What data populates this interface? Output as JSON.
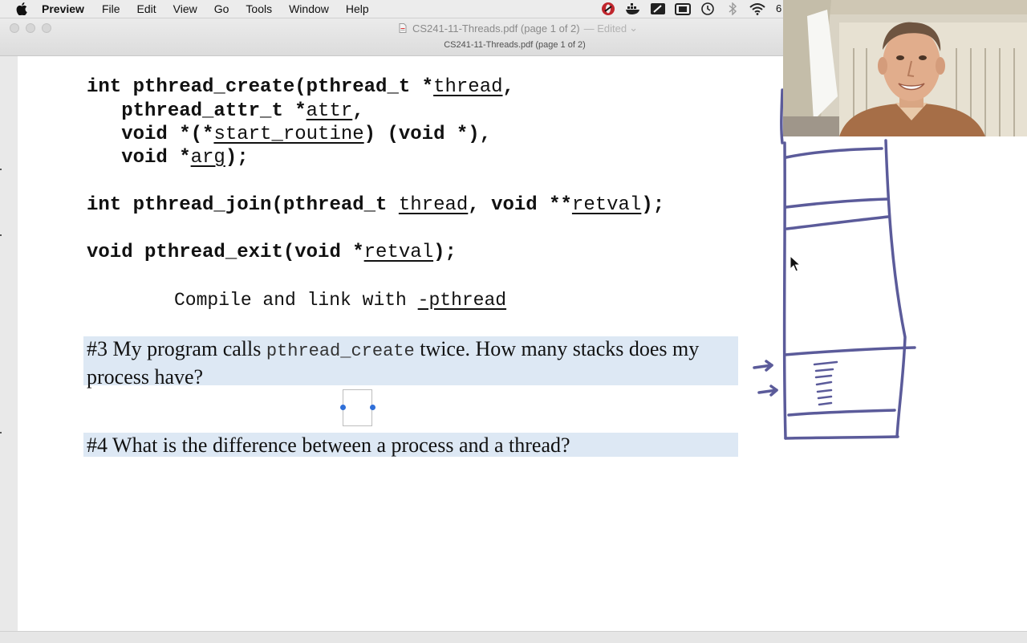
{
  "menubar": {
    "app_name": "Preview",
    "items": [
      "File",
      "Edit",
      "View",
      "Go",
      "Tools",
      "Window",
      "Help"
    ],
    "status_icons": [
      "opera-icon",
      "docker-icon",
      "screen-annotation-icon",
      "screenshot-icon",
      "time-machine-icon",
      "bluetooth-icon",
      "wifi-icon"
    ],
    "battery_text": "6"
  },
  "window": {
    "title": "CS241-11-Threads.pdf (page 1 of 2)",
    "edited_label": "— Edited",
    "chevron": "⌄",
    "subtitle": "CS241-11-Threads.pdf (page 1 of 2)"
  },
  "code": {
    "create_l1": {
      "a": "int pthread_create(pthread_t *",
      "b": "thread",
      "c": ","
    },
    "create_l2": {
      "a": "   pthread_attr_t *",
      "b": "attr",
      "c": ","
    },
    "create_l3": {
      "a": "   void *(*",
      "b": "start_routine",
      "c": ") (void *),"
    },
    "create_l4": {
      "a": "   void *",
      "b": "arg",
      "c": ");"
    },
    "join": {
      "a": "int pthread_join(pthread_t ",
      "b": "thread",
      "c": ", void **",
      "d": "retval",
      "e": ");"
    },
    "exit": {
      "a": "void pthread_exit(void *",
      "b": "retval",
      "c": ");"
    },
    "compile": {
      "a": "Compile and link with ",
      "b": "-pthread"
    }
  },
  "questions": {
    "q3": {
      "before": "#3 My program calls ",
      "mono": "pthread_create",
      "after": " twice. How many stacks does my process have?"
    },
    "q4": {
      "text": "#4 What is the difference between a process and a thread?"
    }
  },
  "colors": {
    "question_highlight": "#dde8f4",
    "ink": "#5b5b9a",
    "selection_handle": "#2f6fd8"
  }
}
